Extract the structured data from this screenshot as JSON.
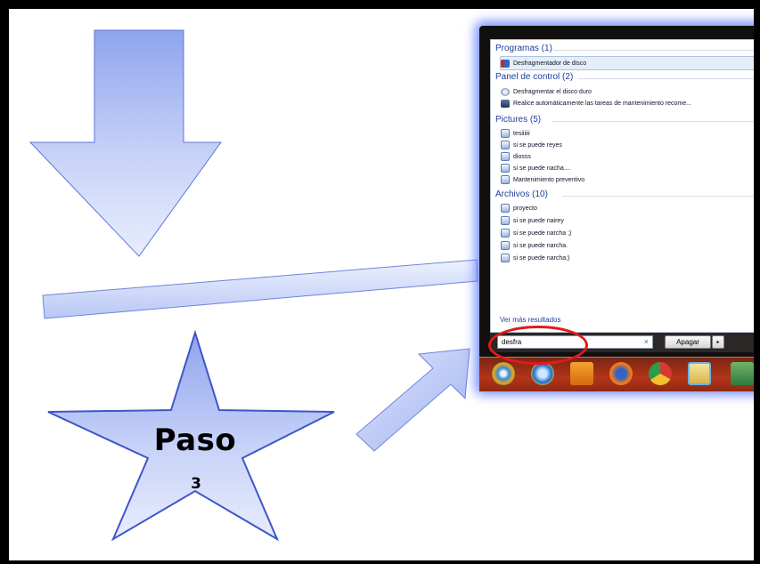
{
  "slide": {
    "star": {
      "title": "Paso",
      "number": "3"
    }
  },
  "start_menu": {
    "sections": [
      {
        "header": "Programas (1)",
        "items": [
          {
            "label": "Desfragmentador de disco",
            "icon": "defrag-icon",
            "selected": true
          }
        ]
      },
      {
        "header": "Panel de control (2)",
        "items": [
          {
            "label": "Desfragmentar el disco duro",
            "icon": "control-panel-icon"
          },
          {
            "label": "Realice automáticamente las tareas de mantenimiento recome...",
            "icon": "maintenance-icon"
          }
        ]
      },
      {
        "header": "Pictures (5)",
        "items": [
          {
            "label": "tesiiiiii",
            "icon": "word-doc-icon"
          },
          {
            "label": "si se puede reyes",
            "icon": "word-doc-icon"
          },
          {
            "label": "diosss",
            "icon": "word-doc-icon"
          },
          {
            "label": "si se puede nacha....",
            "icon": "word-doc-icon"
          },
          {
            "label": "Mantenimiento preventivo",
            "icon": "word-doc-icon"
          }
        ]
      },
      {
        "header": "Archivos (10)",
        "items": [
          {
            "label": "proyecto",
            "icon": "word-doc-icon"
          },
          {
            "label": "si se puede nairey",
            "icon": "word-doc-icon"
          },
          {
            "label": "si se puede narcha ;)",
            "icon": "word-doc-icon"
          },
          {
            "label": "si se puede narcha.",
            "icon": "word-doc-icon"
          },
          {
            "label": "si se puede narcha;)",
            "icon": "word-doc-icon"
          }
        ]
      }
    ],
    "see_more": "Ver más resultados",
    "search_value": "desfra",
    "clear_symbol": "×",
    "shutdown_label": "Apagar",
    "shutdown_arrow": "▸"
  },
  "taskbar": {
    "icons": [
      "start-orb-icon",
      "internet-explorer-icon",
      "media-player-icon",
      "firefox-icon",
      "chrome-icon",
      "folder-icon",
      "app-icon"
    ]
  },
  "colors": {
    "shape_fill": "#c3cff7",
    "shape_stroke": "#3f55c8",
    "highlight_circle": "#e31a1a",
    "glow": "#5a78ff",
    "taskbar": "#b43418"
  }
}
